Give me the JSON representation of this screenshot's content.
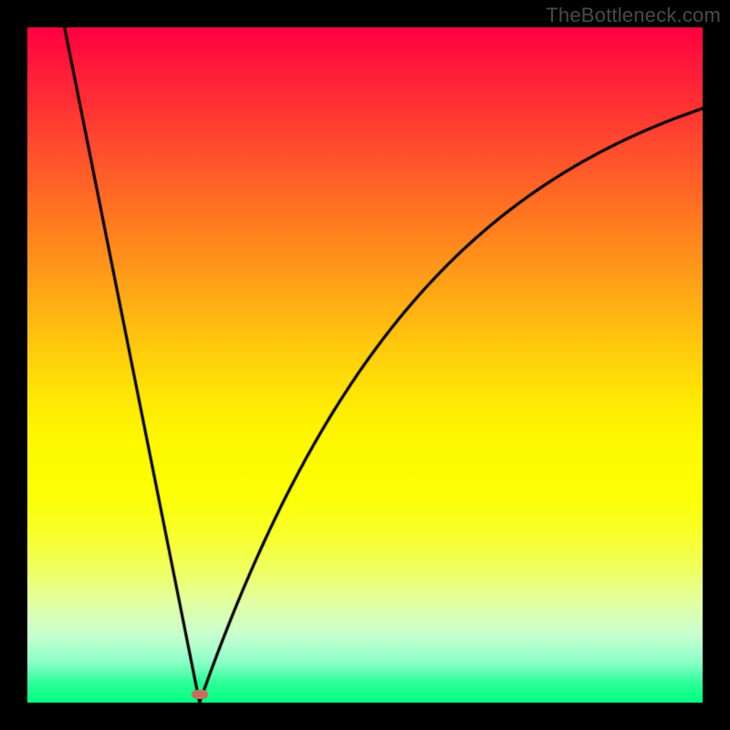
{
  "attribution": "TheBottleneck.com",
  "chart_data": {
    "type": "line",
    "title": "",
    "xlabel": "",
    "ylabel": "",
    "xlim": [
      0,
      1
    ],
    "ylim": [
      0,
      1
    ],
    "series": [
      {
        "name": "bottleneck-curve",
        "segments": [
          {
            "kind": "linear",
            "x0": 0.055,
            "y0": 1.0,
            "x1": 0.255,
            "y1": 0.0
          },
          {
            "kind": "custom",
            "x0": 0.255,
            "xEnd": 1.0,
            "yAtXEnd": 0.88,
            "yMax": 1.0
          }
        ]
      }
    ],
    "marker": {
      "x": 0.255,
      "y": 0.012,
      "color": "#c47060"
    },
    "background": {
      "type": "vertical-gradient",
      "stops": [
        {
          "pos": 0.0,
          "color": "#ff0040"
        },
        {
          "pos": 0.5,
          "color": "#ffcc0c"
        },
        {
          "pos": 0.75,
          "color": "#f8ff2a"
        },
        {
          "pos": 1.0,
          "color": "#00ff80"
        }
      ]
    }
  }
}
